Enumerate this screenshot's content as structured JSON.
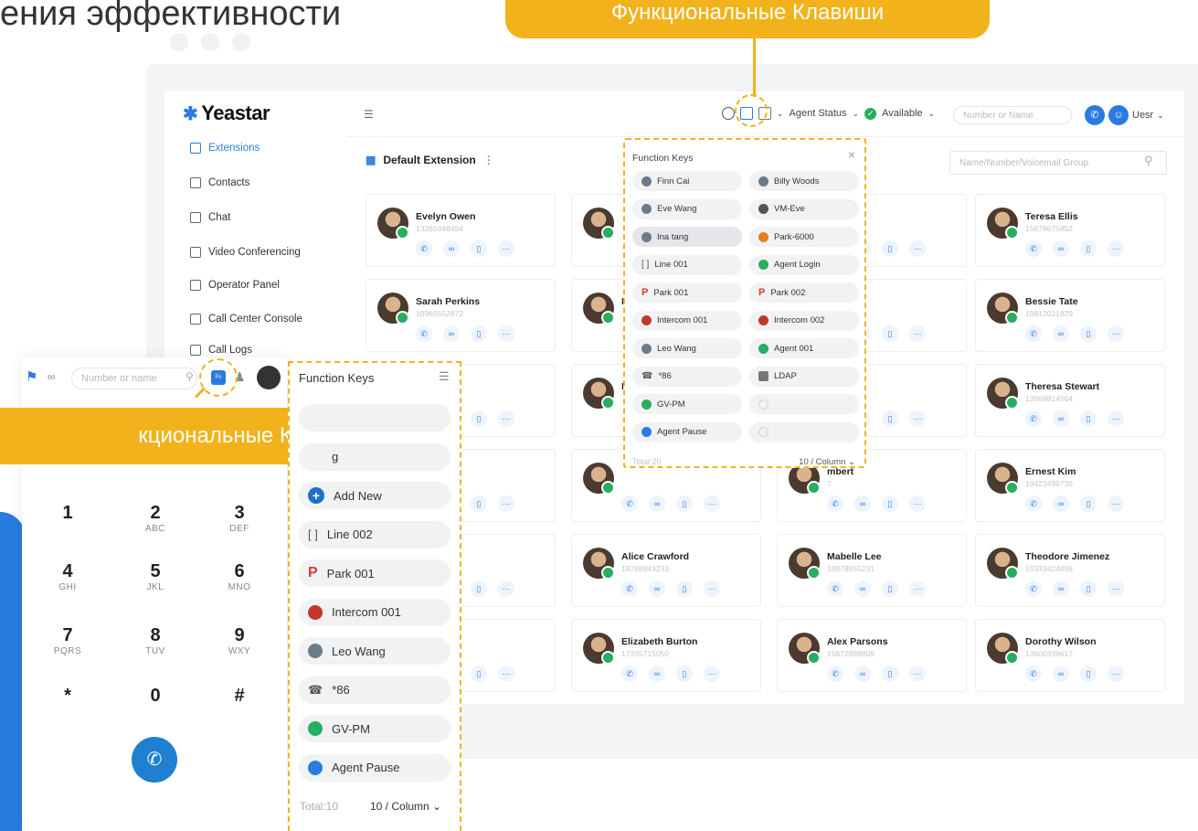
{
  "headline": "ения эффективности",
  "callouts": {
    "top": "Функциональные Клавиши",
    "left": "кциональные Клавиши"
  },
  "colors": {
    "accent": "#f2b21b",
    "brand": "#2a7be0",
    "online": "#27ae60"
  },
  "app": {
    "logo": "Yeastar",
    "nav": [
      {
        "label": "Extensions",
        "icon": "extensions-icon"
      },
      {
        "label": "Contacts",
        "icon": "contacts-icon"
      },
      {
        "label": "Chat",
        "icon": "chat-icon"
      },
      {
        "label": "Video Conferencing",
        "icon": "video-icon"
      },
      {
        "label": "Operator Panel",
        "icon": "operator-panel-icon"
      },
      {
        "label": "Call Center Console",
        "icon": "headset-icon"
      },
      {
        "label": "Call Logs",
        "icon": "call-logs-icon"
      }
    ],
    "topbar": {
      "agent_status": "Agent Status",
      "available": "Available",
      "search_placeholder": "Number or Name",
      "user": "Uesr"
    },
    "group_title": "Default Extension",
    "filter_placeholder": "Name/Number/Voicemail Group",
    "cards": [
      {
        "name": "Evelyn Owen",
        "number": "13265048494"
      },
      {
        "name": "",
        "number": ""
      },
      {
        "name": "",
        "number": ""
      },
      {
        "name": "Teresa Ellis",
        "number": "15678675852"
      },
      {
        "name": "Sarah Perkins",
        "number": "18966552872"
      },
      {
        "name": "P",
        "number": ""
      },
      {
        "name": "ce",
        "number": "0"
      },
      {
        "name": "Bessie Tate",
        "number": "19812021829"
      },
      {
        "name": "",
        "number": ""
      },
      {
        "name": "L",
        "number": ""
      },
      {
        "name": "s",
        "number": ""
      },
      {
        "name": "Theresa Stewart",
        "number": "13969814564"
      },
      {
        "name": "nning",
        "number": ""
      },
      {
        "name": "",
        "number": ""
      },
      {
        "name": "mbert",
        "number": "7"
      },
      {
        "name": "Ernest Kim",
        "number": "19423499735"
      },
      {
        "name": "nandez",
        "number": ""
      },
      {
        "name": "Alice Crawford",
        "number": "18788843233"
      },
      {
        "name": "Mabelle Lee",
        "number": "18878855231"
      },
      {
        "name": "Theodore Jimenez",
        "number": "15933424898"
      },
      {
        "name": "ell",
        "number": ""
      },
      {
        "name": "Elizabeth Burton",
        "number": "17335715050"
      },
      {
        "name": "Alex Parsons",
        "number": "15672898809"
      },
      {
        "name": "Dorothy Wilson",
        "number": "13600339617"
      }
    ],
    "function_keys": {
      "title": "Function Keys",
      "items": [
        {
          "label": "Finn Cai",
          "icon": "contact-icon"
        },
        {
          "label": "Billy Woods",
          "icon": "contact-icon"
        },
        {
          "label": "Eve Wang",
          "icon": "contact-icon"
        },
        {
          "label": "VM-Eve",
          "icon": "voicemail-icon"
        },
        {
          "label": "Ina tang",
          "icon": "contact-icon"
        },
        {
          "label": "Park-6000",
          "icon": "park-icon"
        },
        {
          "label": "Line 001",
          "icon": "line-icon"
        },
        {
          "label": "Agent Login",
          "icon": "agent-icon"
        },
        {
          "label": "Park 001",
          "icon": "park-p-icon"
        },
        {
          "label": "Park 002",
          "icon": "park-p-icon"
        },
        {
          "label": "Intercom 001",
          "icon": "intercom-icon"
        },
        {
          "label": "Intercom 002",
          "icon": "intercom-icon"
        },
        {
          "label": "Leo Wang",
          "icon": "contact-icon"
        },
        {
          "label": "Agent 001",
          "icon": "agent-icon"
        },
        {
          "label": "*86",
          "icon": "dtmf-icon"
        },
        {
          "label": "LDAP",
          "icon": "ldap-icon"
        },
        {
          "label": "GV-PM",
          "icon": "group-icon"
        },
        {
          "label": "",
          "icon": "empty-icon"
        },
        {
          "label": "Agent Pause",
          "icon": "agent-pause-icon"
        },
        {
          "label": "",
          "icon": "empty-icon"
        }
      ],
      "total": "Total:20",
      "per_page": "10 / Column"
    }
  },
  "phone": {
    "search_placeholder": "Number or name",
    "badge": "Fn",
    "keys": [
      {
        "digit": "1",
        "letters": ""
      },
      {
        "digit": "2",
        "letters": "ABC"
      },
      {
        "digit": "3",
        "letters": "DEF"
      },
      {
        "digit": "4",
        "letters": "GHI"
      },
      {
        "digit": "5",
        "letters": "JKL"
      },
      {
        "digit": "6",
        "letters": "MNO"
      },
      {
        "digit": "7",
        "letters": "PQRS"
      },
      {
        "digit": "8",
        "letters": "TUV"
      },
      {
        "digit": "9",
        "letters": "WXY"
      },
      {
        "digit": "*",
        "letters": ""
      },
      {
        "digit": "0",
        "letters": ""
      },
      {
        "digit": "#",
        "letters": ""
      }
    ],
    "function_keys": {
      "title": "Function Keys",
      "items": [
        {
          "label": "",
          "icon": "empty-icon"
        },
        {
          "label": "g",
          "icon": "empty-icon"
        },
        {
          "label": "Add New",
          "icon": "add-icon"
        },
        {
          "label": "Line 002",
          "icon": "line-icon"
        },
        {
          "label": "Park 001",
          "icon": "park-p-icon"
        },
        {
          "label": "Intercom 001",
          "icon": "intercom-icon"
        },
        {
          "label": "Leo Wang",
          "icon": "contact-icon"
        },
        {
          "label": "*86",
          "icon": "dtmf-icon"
        },
        {
          "label": "GV-PM",
          "icon": "group-icon"
        },
        {
          "label": "Agent Pause",
          "icon": "agent-pause-icon"
        }
      ],
      "total": "Total:10",
      "per_page": "10 / Column"
    }
  }
}
